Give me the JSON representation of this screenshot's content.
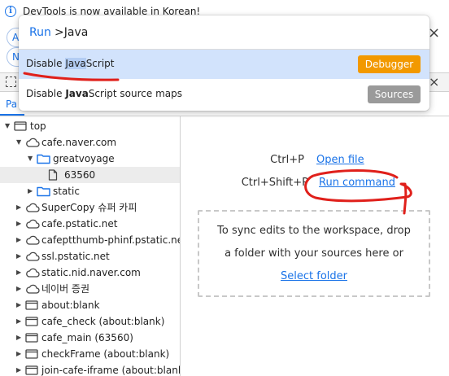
{
  "infobar": {
    "icon": "info-icon",
    "text": "DevTools is now available in Korean!",
    "action_1": "A",
    "action_2": "N"
  },
  "subtabs": {
    "page_tab": "Pa"
  },
  "palette": {
    "prompt": "Run",
    "query": ">Java",
    "items": [
      {
        "title_prefix": "Disable ",
        "title_match": "Java",
        "title_suffix": "Script",
        "badge": "Debugger",
        "badge_color": "#f29900"
      },
      {
        "title_prefix": "Disable ",
        "title_match": "Java",
        "title_suffix": "Script source maps",
        "badge": "Sources",
        "badge_color": "#9a9a9a"
      }
    ]
  },
  "tree": [
    {
      "label": "top",
      "icon": "frame-icon",
      "expanded": true
    },
    {
      "label": "cafe.naver.com",
      "icon": "cloud-icon",
      "expanded": true
    },
    {
      "label": "greatvoyage",
      "icon": "folder-icon",
      "expanded": true
    },
    {
      "label": "63560",
      "icon": "file-icon",
      "selected": true
    },
    {
      "label": "static",
      "icon": "folder-icon",
      "expanded": false
    },
    {
      "label": "SuperCopy 슈퍼 카피",
      "icon": "cloud-icon",
      "expanded": false
    },
    {
      "label": "cafe.pstatic.net",
      "icon": "cloud-icon",
      "expanded": false
    },
    {
      "label": "cafeptthumb-phinf.pstatic.net",
      "icon": "cloud-icon",
      "expanded": false
    },
    {
      "label": "ssl.pstatic.net",
      "icon": "cloud-icon",
      "expanded": false
    },
    {
      "label": "static.nid.naver.com",
      "icon": "cloud-icon",
      "expanded": false
    },
    {
      "label": "네이버 증권",
      "icon": "cloud-icon",
      "expanded": false
    },
    {
      "label": "about:blank",
      "icon": "frame-icon",
      "expanded": false
    },
    {
      "label": "cafe_check (about:blank)",
      "icon": "frame-icon",
      "expanded": false
    },
    {
      "label": "cafe_main (63560)",
      "icon": "frame-icon",
      "expanded": false
    },
    {
      "label": "checkFrame (about:blank)",
      "icon": "frame-icon",
      "expanded": false
    },
    {
      "label": "join-cafe-iframe (about:blank)",
      "icon": "frame-icon",
      "expanded": false
    }
  ],
  "main": {
    "open_file_shortcut": "Ctrl+P",
    "open_file_link": "Open file",
    "run_command_shortcut": "Ctrl+Shift+P",
    "run_command_link": "Run command",
    "drop_line_1": "To sync edits to the workspace, drop",
    "drop_line_2": "a folder with your sources here or",
    "select_folder": "Select folder"
  },
  "colors": {
    "accent": "#1a73e8",
    "selected_item": "#d2e3fc",
    "annotation": "#e0201b"
  }
}
